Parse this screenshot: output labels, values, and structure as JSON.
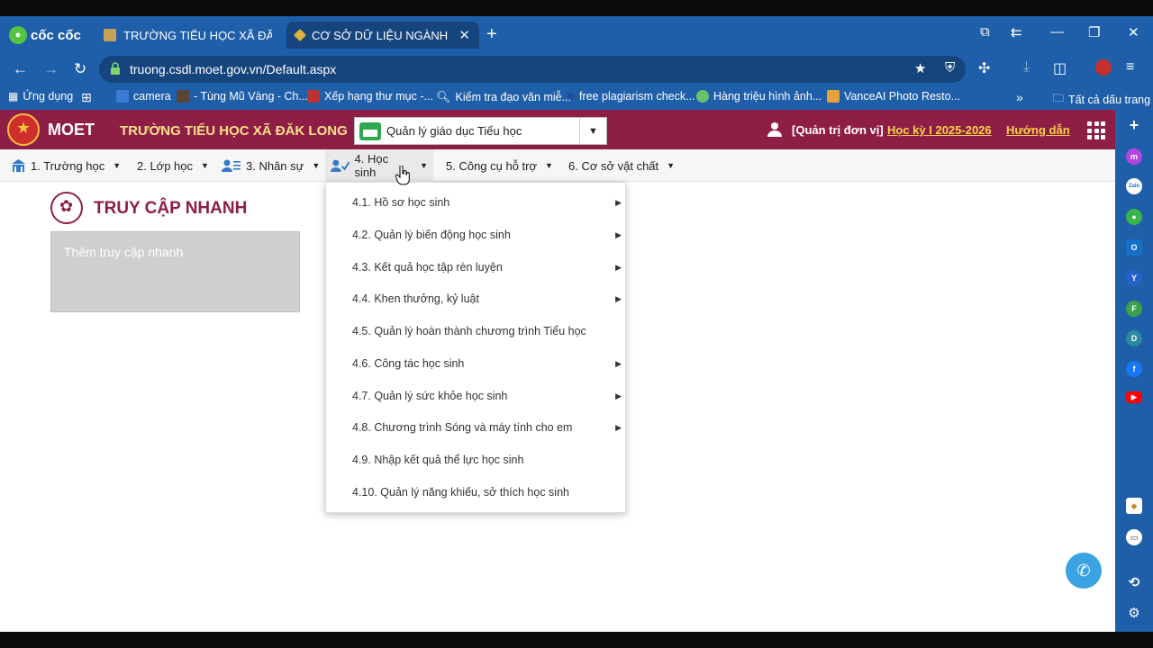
{
  "browser": {
    "brand": "cốc cốc",
    "tabs": [
      {
        "title": "TRƯỜNG TIỂU HỌC XÃ ĐĂK LON",
        "active": false
      },
      {
        "title": "CƠ SỞ DỮ LIỆU NGÀNH GI",
        "active": true
      }
    ],
    "url": "truong.csdl.moet.gov.vn/Default.aspx",
    "bookmarks": [
      "Ứng dụng",
      "camera",
      "- Tùng Mũ Vàng - Ch...",
      "Xếp hạng thư mục -...",
      "Kiểm tra đạo văn miễ...",
      "free plagiarism check...",
      "Hàng triệu hình ảnh...",
      "VanceAI Photo Resto...",
      "Tất cả dấu trang"
    ],
    "bookmark_more": "»"
  },
  "header": {
    "brand": "MOET",
    "school": "TRƯỜNG TIỂU HỌC XÃ ĐĂK LONG",
    "module_select": "Quản lý giáo dục Tiểu học",
    "admin": "[Quản trị đơn vị]",
    "semester": "Học kỳ I 2025-2026",
    "guide": "Hướng dẫn"
  },
  "menu": [
    {
      "label": "1. Trường học"
    },
    {
      "label": "2. Lớp học"
    },
    {
      "label": "3. Nhân sự"
    },
    {
      "label": "4. Học sinh"
    },
    {
      "label": "5. Công cụ hỗ trợ"
    },
    {
      "label": "6. Cơ sở vật chất"
    }
  ],
  "dropdown": [
    {
      "label": "4.1. Hồ sơ học sinh",
      "submenu": true
    },
    {
      "label": "4.2. Quản lý biến động học sinh",
      "submenu": true
    },
    {
      "label": "4.3. Kết quả học tập rèn luyện",
      "submenu": true
    },
    {
      "label": "4.4. Khen thưởng, kỷ luật",
      "submenu": true
    },
    {
      "label": "4.5. Quản lý hoàn thành chương trình Tiểu học",
      "submenu": false
    },
    {
      "label": "4.6. Công tác học sinh",
      "submenu": true
    },
    {
      "label": "4.7. Quản lý sức khỏe học sinh",
      "submenu": true
    },
    {
      "label": "4.8. Chương trình Sóng và máy tính cho em",
      "submenu": true
    },
    {
      "label": "4.9. Nhập kết quả thể lực học sinh",
      "submenu": false
    },
    {
      "label": "4.10. Quản lý năng khiếu, sở thích học sinh",
      "submenu": false
    }
  ],
  "quick_access": {
    "title": "TRUY CẬP NHANH",
    "add_label": "Thêm truy cập nhanh"
  },
  "sidebar_icons": [
    "messenger-icon",
    "zalo-icon",
    "game-icon",
    "outlook-icon",
    "y-icon",
    "f-icon",
    "d-icon",
    "facebook-icon",
    "youtube-icon",
    "app-icon",
    "tv-icon",
    "history-icon",
    "settings-icon"
  ],
  "colors": {
    "chrome": "#1f5ea8",
    "header": "#8f1e46",
    "accent_yellow": "#f7d24a"
  }
}
